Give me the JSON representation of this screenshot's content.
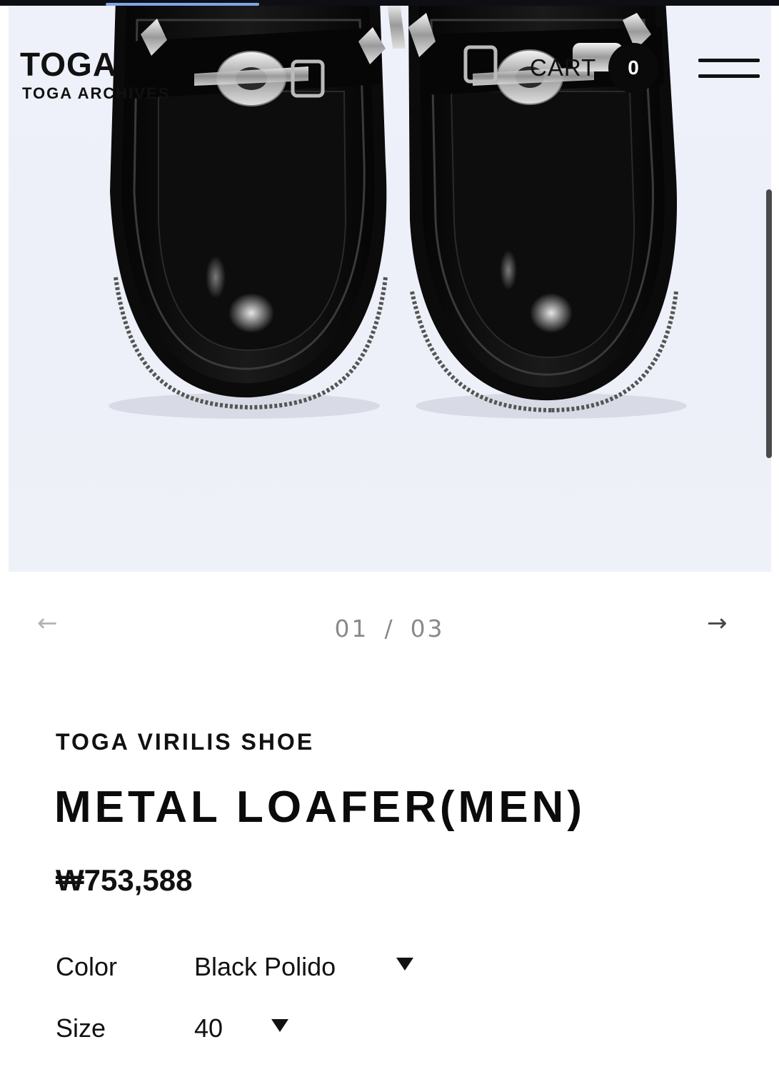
{
  "header": {
    "brand": "TOGA",
    "sub_brand": "TOGA ARCHIVES",
    "cart_label": "CART",
    "cart_count": "0",
    "menu_icon": "hamburger-icon"
  },
  "gallery": {
    "current": "01",
    "separator": "/",
    "total": "03",
    "prev_icon": "arrow-left-icon",
    "next_icon": "arrow-right-icon",
    "prev_symbol": "←",
    "next_symbol": "→",
    "image_subject": "black leather loafers with silver metal hardware"
  },
  "product": {
    "collection": "TOGA VIRILIS SHOE",
    "title": "METAL LOAFER(MEN)",
    "price": "₩753,588",
    "options": [
      {
        "label": "Color",
        "value": "Black Polido"
      },
      {
        "label": "Size",
        "value": "40"
      }
    ]
  },
  "colors": {
    "accent_progress": "#7fa6e8",
    "background": "#ffffff",
    "image_background": "#eef1f8",
    "text": "#111111",
    "pager_text": "#8a8a8a"
  }
}
